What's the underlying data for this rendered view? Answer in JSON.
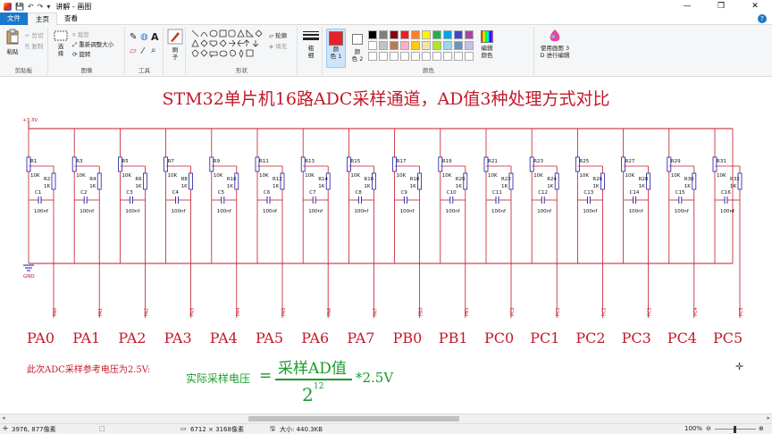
{
  "window": {
    "title": "讲解 - 画图",
    "quick_access": [
      "💾",
      "↶",
      "↷",
      "▾"
    ],
    "controls": [
      "—",
      "❐",
      "✕"
    ]
  },
  "tabs": [
    {
      "label": "文件"
    },
    {
      "label": "主页"
    },
    {
      "label": "查看"
    }
  ],
  "ribbon": {
    "clipboard": {
      "paste": "粘贴",
      "cut": "剪切",
      "copy": "复制",
      "group": "剪贴板"
    },
    "image": {
      "select": "选\n择",
      "crop": "裁剪",
      "resize": "重新调整大小",
      "rotate": "旋转",
      "group": "图像"
    },
    "tools": {
      "group": "工具",
      "pencil": "✎",
      "fill": "◍",
      "text": "A",
      "eraser": "▱",
      "picker": "⁄",
      "magnifier": "⌕"
    },
    "brush": {
      "label": "刷\n子"
    },
    "shapes": {
      "outline": "轮廓",
      "fill": "填充",
      "group": "形状"
    },
    "size": {
      "label": "粗\n细"
    },
    "color1": {
      "label": "颜\n色 1",
      "value": "#e8202a"
    },
    "color2": {
      "label": "颜\n色 2",
      "value": "#ffffff"
    },
    "palette": [
      "#000000",
      "#7f7f7f",
      "#880015",
      "#ed1c24",
      "#ff7f27",
      "#fff200",
      "#22b14c",
      "#00a2e8",
      "#3f48cc",
      "#a349a4",
      "#ffffff",
      "#c3c3c3",
      "#b97a57",
      "#ffaec9",
      "#ffc90e",
      "#efe4b0",
      "#b5e61d",
      "#99d9ea",
      "#7092be",
      "#c8bfe7"
    ],
    "edit_colors": "编辑\n颜色",
    "paint3d": "使用画图 3\nD 进行编辑",
    "colors_group": "颜色"
  },
  "canvas": {
    "title": "STM32单片机16路ADC采样通道，AD值3种处理方式对比",
    "vcc_label": "+3.3V",
    "gnd_label": "GND",
    "channels": [
      {
        "r_top": "R1",
        "r_side": "R2",
        "c": "C1",
        "pin": "PA0"
      },
      {
        "r_top": "R3",
        "r_side": "R4",
        "c": "C2",
        "pin": "PA1"
      },
      {
        "r_top": "R5",
        "r_side": "R6",
        "c": "C3",
        "pin": "PA2"
      },
      {
        "r_top": "R7",
        "r_side": "R8",
        "c": "C4",
        "pin": "PA3"
      },
      {
        "r_top": "R9",
        "r_side": "R10",
        "c": "C5",
        "pin": "PA4"
      },
      {
        "r_top": "R11",
        "r_side": "R12",
        "c": "C6",
        "pin": "PA5"
      },
      {
        "r_top": "R13",
        "r_side": "R14",
        "c": "C7",
        "pin": "PA6"
      },
      {
        "r_top": "R15",
        "r_side": "R16",
        "c": "C8",
        "pin": "PA7"
      },
      {
        "r_top": "R17",
        "r_side": "R18",
        "c": "C9",
        "pin": "PB0"
      },
      {
        "r_top": "R19",
        "r_side": "R20",
        "c": "C10",
        "pin": "PB1"
      },
      {
        "r_top": "R21",
        "r_side": "R22",
        "c": "C11",
        "pin": "PC0"
      },
      {
        "r_top": "R23",
        "r_side": "R24",
        "c": "C12",
        "pin": "PC1"
      },
      {
        "r_top": "R25",
        "r_side": "R26",
        "c": "C13",
        "pin": "PC2"
      },
      {
        "r_top": "R27",
        "r_side": "R28",
        "c": "C14",
        "pin": "PC3"
      },
      {
        "r_top": "R29",
        "r_side": "R30",
        "c": "C15",
        "pin": "PC4"
      },
      {
        "r_top": "R31",
        "r_side": "R32",
        "c": "C16",
        "pin": "PC5"
      }
    ],
    "r_value": "10K",
    "r_side_value": "1K",
    "c_value": "100nf",
    "note": "此次ADC采样参考电压为2.5V:",
    "formula": {
      "lhs": "实际采样电压",
      "eq": "=",
      "num": "采样AD值",
      "den_base": "2",
      "den_exp": "12",
      "mul": "*2.5V"
    }
  },
  "status": {
    "cursor": "3976, 877像素",
    "selection": "",
    "dimensions": "6712 × 3168像素",
    "size": "大小: 440.3KB",
    "zoom": "100%"
  }
}
